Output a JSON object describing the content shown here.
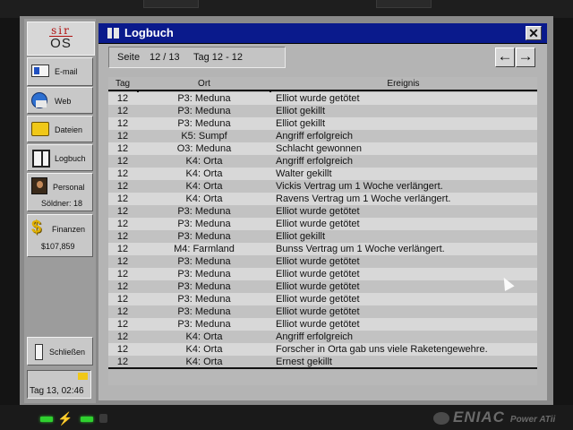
{
  "sidebar": {
    "logo_top": "sir",
    "logo_bottom": "OS",
    "email_label": "E-mail",
    "web_label": "Web",
    "files_label": "Dateien",
    "logbook_label": "Logbuch",
    "personnel_label": "Personal",
    "mercs_label": "Söldner: 18",
    "finances_label": "Finanzen",
    "balance": "$107,859",
    "exit_label": "Schließen",
    "datetime": "Tag 13, 02:46"
  },
  "window": {
    "title": "Logbuch",
    "close_glyph": "✕",
    "page_label": "Seite",
    "page_value": "12 / 13",
    "day_range": "Tag 12 - 12",
    "prev_glyph": "←",
    "next_glyph": "→"
  },
  "table": {
    "headers": {
      "tag": "Tag",
      "ort": "Ort",
      "ereignis": "Ereignis"
    },
    "rows": [
      {
        "tag": "12",
        "ort": "P3: Meduna",
        "ereignis": "Elliot wurde getötet"
      },
      {
        "tag": "12",
        "ort": "P3: Meduna",
        "ereignis": "Elliot gekillt"
      },
      {
        "tag": "12",
        "ort": "P3: Meduna",
        "ereignis": "Elliot gekillt"
      },
      {
        "tag": "12",
        "ort": "K5: Sumpf",
        "ereignis": "Angriff erfolgreich"
      },
      {
        "tag": "12",
        "ort": "O3: Meduna",
        "ereignis": "Schlacht gewonnen"
      },
      {
        "tag": "12",
        "ort": "K4: Orta",
        "ereignis": "Angriff erfolgreich"
      },
      {
        "tag": "12",
        "ort": "K4: Orta",
        "ereignis": "Walter gekillt"
      },
      {
        "tag": "12",
        "ort": "K4: Orta",
        "ereignis": "Vickis Vertrag um 1 Woche verlängert."
      },
      {
        "tag": "12",
        "ort": "K4: Orta",
        "ereignis": "Ravens Vertrag um 1 Woche verlängert."
      },
      {
        "tag": "12",
        "ort": "P3: Meduna",
        "ereignis": "Elliot wurde getötet"
      },
      {
        "tag": "12",
        "ort": "P3: Meduna",
        "ereignis": "Elliot wurde getötet"
      },
      {
        "tag": "12",
        "ort": "P3: Meduna",
        "ereignis": "Elliot gekillt"
      },
      {
        "tag": "12",
        "ort": "M4: Farmland",
        "ereignis": "Bunss Vertrag um 1 Woche verlängert."
      },
      {
        "tag": "12",
        "ort": "P3: Meduna",
        "ereignis": "Elliot wurde getötet"
      },
      {
        "tag": "12",
        "ort": "P3: Meduna",
        "ereignis": "Elliot wurde getötet"
      },
      {
        "tag": "12",
        "ort": "P3: Meduna",
        "ereignis": "Elliot wurde getötet"
      },
      {
        "tag": "12",
        "ort": "P3: Meduna",
        "ereignis": "Elliot wurde getötet"
      },
      {
        "tag": "12",
        "ort": "P3: Meduna",
        "ereignis": "Elliot wurde getötet"
      },
      {
        "tag": "12",
        "ort": "P3: Meduna",
        "ereignis": "Elliot wurde getötet"
      },
      {
        "tag": "12",
        "ort": "K4: Orta",
        "ereignis": "Angriff erfolgreich"
      },
      {
        "tag": "12",
        "ort": "K4: Orta",
        "ereignis": "Forscher in Orta gab uns viele Raketengewehre."
      },
      {
        "tag": "12",
        "ort": "K4: Orta",
        "ereignis": "Ernest gekillt"
      }
    ]
  },
  "brand": {
    "logo": "ENIAC",
    "model": "Power ATii"
  },
  "icons": [
    "email-icon",
    "web-icon",
    "files-icon",
    "logbook-icon",
    "personnel-icon",
    "money-icon",
    "exit-icon",
    "folder-icon",
    "close-icon",
    "arrow-left-icon",
    "arrow-right-icon"
  ],
  "colors": {
    "titlebar": "#0a1a8c",
    "led": "#2fd12f",
    "logo_red": "#b01010"
  }
}
